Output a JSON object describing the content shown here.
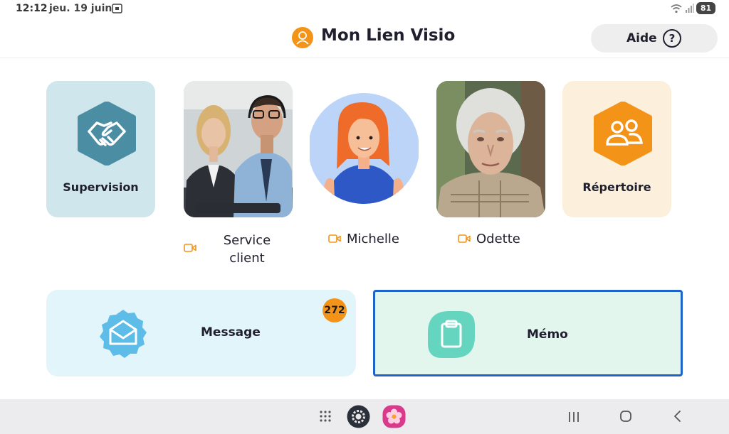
{
  "status_bar": {
    "time": "12:12",
    "date": "jeu. 19 juin",
    "battery": "81"
  },
  "header": {
    "title": "Mon Lien Visio",
    "help_label": "Aide",
    "help_icon_glyph": "?"
  },
  "tiles": {
    "supervision": {
      "label": "Supervision",
      "icon": "handshake-icon"
    },
    "repertoire": {
      "label": "Répertoire",
      "icon": "contacts-icon"
    }
  },
  "contacts": [
    {
      "name_line1": "Service",
      "name_line2": "client",
      "call_icon": "video-camera-icon"
    },
    {
      "name": "Michelle",
      "call_icon": "video-camera-icon"
    },
    {
      "name": "Odette",
      "call_icon": "video-camera-icon"
    }
  ],
  "cards": {
    "message": {
      "label": "Message",
      "badge": "272",
      "icon": "envelope-icon"
    },
    "memo": {
      "label": "Mémo",
      "icon": "clipboard-icon"
    }
  },
  "colors": {
    "accent": "#f39418",
    "focus": "#1e63c9",
    "supervision_bg": "#cfe6ec",
    "repertoire_bg": "#fcefdc"
  }
}
